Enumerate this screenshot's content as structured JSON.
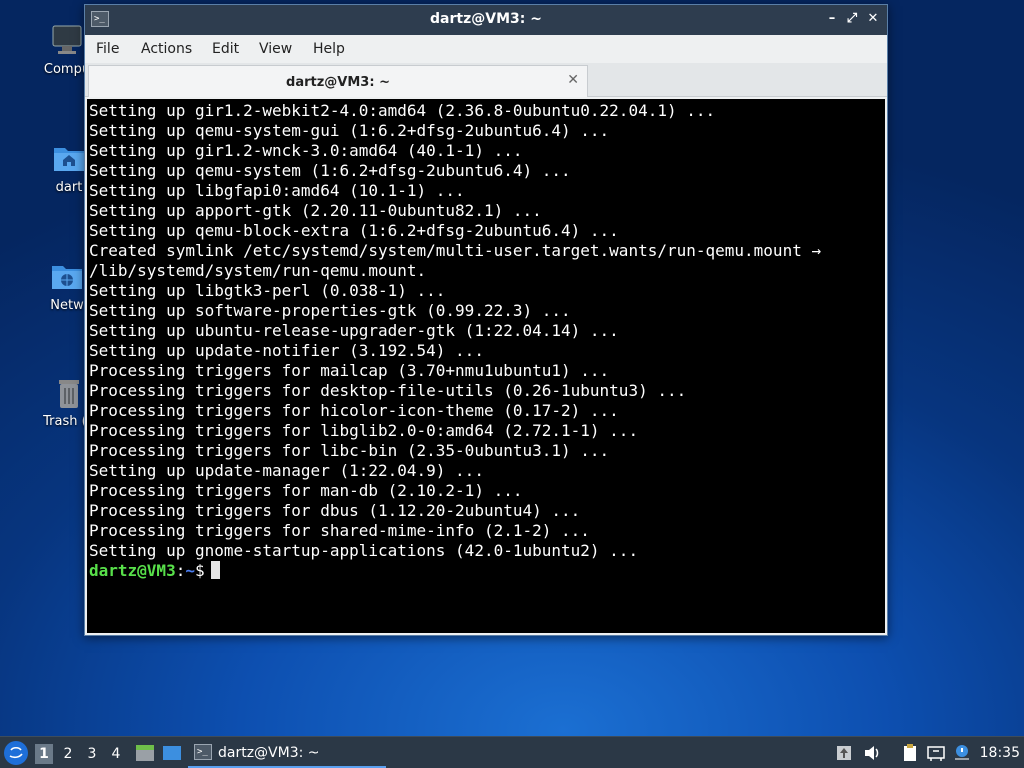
{
  "desktop": {
    "icons": [
      {
        "label": "Compu",
        "icon": "computer-icon"
      },
      {
        "label": "dart",
        "icon": "home-folder-icon"
      },
      {
        "label": "Netw",
        "icon": "network-folder-icon"
      },
      {
        "label": "Trash (E",
        "icon": "trash-icon"
      }
    ]
  },
  "window": {
    "title": "dartz@VM3: ~",
    "buttons": {
      "minimize": "–",
      "maximize": "⤢",
      "close": "✕"
    },
    "menu": [
      "File",
      "Actions",
      "Edit",
      "View",
      "Help"
    ],
    "tab": {
      "label": "dartz@VM3: ~",
      "close": "✕"
    }
  },
  "terminal": {
    "lines": [
      "Setting up gir1.2-webkit2-4.0:amd64 (2.36.8-0ubuntu0.22.04.1) ...",
      "Setting up qemu-system-gui (1:6.2+dfsg-2ubuntu6.4) ...",
      "Setting up gir1.2-wnck-3.0:amd64 (40.1-1) ...",
      "Setting up qemu-system (1:6.2+dfsg-2ubuntu6.4) ...",
      "Setting up libgfapi0:amd64 (10.1-1) ...",
      "Setting up apport-gtk (2.20.11-0ubuntu82.1) ...",
      "Setting up qemu-block-extra (1:6.2+dfsg-2ubuntu6.4) ...",
      "Created symlink /etc/systemd/system/multi-user.target.wants/run-qemu.mount →",
      "/lib/systemd/system/run-qemu.mount.",
      "Setting up libgtk3-perl (0.038-1) ...",
      "Setting up software-properties-gtk (0.99.22.3) ...",
      "Setting up ubuntu-release-upgrader-gtk (1:22.04.14) ...",
      "Setting up update-notifier (3.192.54) ...",
      "Processing triggers for mailcap (3.70+nmu1ubuntu1) ...",
      "Processing triggers for desktop-file-utils (0.26-1ubuntu3) ...",
      "Processing triggers for hicolor-icon-theme (0.17-2) ...",
      "Processing triggers for libglib2.0-0:amd64 (2.72.1-1) ...",
      "Processing triggers for libc-bin (2.35-0ubuntu3.1) ...",
      "Setting up update-manager (1:22.04.9) ...",
      "Processing triggers for man-db (2.10.2-1) ...",
      "Processing triggers for dbus (1.12.20-2ubuntu4) ...",
      "Processing triggers for shared-mime-info (2.1-2) ...",
      "Setting up gnome-startup-applications (42.0-1ubuntu2) ..."
    ],
    "prompt": {
      "user_host": "dartz@VM3",
      "sep": ":",
      "path": "~",
      "symbol": "$"
    }
  },
  "taskbar": {
    "workspaces": [
      "1",
      "2",
      "3",
      "4"
    ],
    "active_workspace": "1",
    "task_label": "dartz@VM3: ~",
    "clock": "18:35",
    "accent": "#5aa0f0"
  }
}
